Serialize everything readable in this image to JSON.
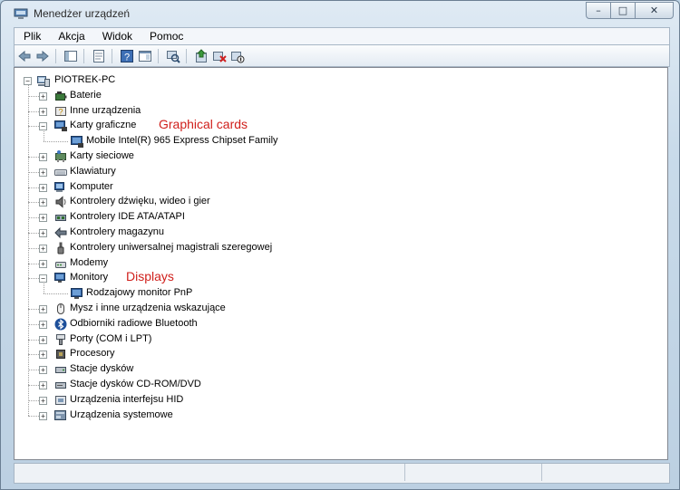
{
  "window": {
    "title": "Menedżer urządzeń",
    "caption_buttons": [
      "–",
      "□",
      "✕"
    ]
  },
  "menubar": [
    "Plik",
    "Akcja",
    "Widok",
    "Pomoc"
  ],
  "toolbar": {
    "icons": [
      "back-icon",
      "forward-icon",
      "show-hide-tree-icon",
      "properties-icon",
      "help-icon",
      "console-icon",
      "scan-hardware-icon",
      "update-driver-icon",
      "uninstall-icon",
      "disable-icon"
    ]
  },
  "tree": {
    "root": "PIOTREK-PC",
    "items": [
      {
        "label": "Baterie",
        "icon": "battery-icon",
        "expanded": false
      },
      {
        "label": "Inne urządzenia",
        "icon": "unknown-device-icon",
        "expanded": false
      },
      {
        "label": "Karty graficzne",
        "icon": "display-adapter-icon",
        "expanded": true,
        "children": [
          "Mobile Intel(R) 965 Express Chipset Family"
        ]
      },
      {
        "label": "Karty sieciowe",
        "icon": "network-adapter-icon",
        "expanded": false
      },
      {
        "label": "Klawiatury",
        "icon": "keyboard-icon",
        "expanded": false
      },
      {
        "label": "Komputer",
        "icon": "computer-icon",
        "expanded": false
      },
      {
        "label": "Kontrolery dźwięku, wideo i gier",
        "icon": "speaker-icon",
        "expanded": false
      },
      {
        "label": "Kontrolery IDE ATA/ATAPI",
        "icon": "ide-controller-icon",
        "expanded": false
      },
      {
        "label": "Kontrolery magazynu",
        "icon": "storage-controller-icon",
        "expanded": false
      },
      {
        "label": "Kontrolery uniwersalnej magistrali szeregowej",
        "icon": "usb-icon",
        "expanded": false
      },
      {
        "label": "Modemy",
        "icon": "modem-icon",
        "expanded": false
      },
      {
        "label": "Monitory",
        "icon": "monitor-icon",
        "expanded": true,
        "children": [
          "Rodzajowy monitor PnP"
        ]
      },
      {
        "label": "Mysz i inne urządzenia wskazujące",
        "icon": "mouse-icon",
        "expanded": false
      },
      {
        "label": "Odbiorniki radiowe Bluetooth",
        "icon": "bluetooth-icon",
        "expanded": false
      },
      {
        "label": "Porty (COM i LPT)",
        "icon": "port-icon",
        "expanded": false
      },
      {
        "label": "Procesory",
        "icon": "processor-icon",
        "expanded": false
      },
      {
        "label": "Stacje dysków",
        "icon": "disk-drive-icon",
        "expanded": false
      },
      {
        "label": "Stacje dysków CD-ROM/DVD",
        "icon": "cdrom-icon",
        "expanded": false
      },
      {
        "label": "Urządzenia interfejsu HID",
        "icon": "hid-icon",
        "expanded": false
      },
      {
        "label": "Urządzenia systemowe",
        "icon": "system-device-icon",
        "expanded": false
      }
    ]
  },
  "annotations": {
    "graphical_cards": "Graphical cards",
    "displays": "Displays"
  },
  "colors": {
    "annotation": "#d0201c"
  }
}
